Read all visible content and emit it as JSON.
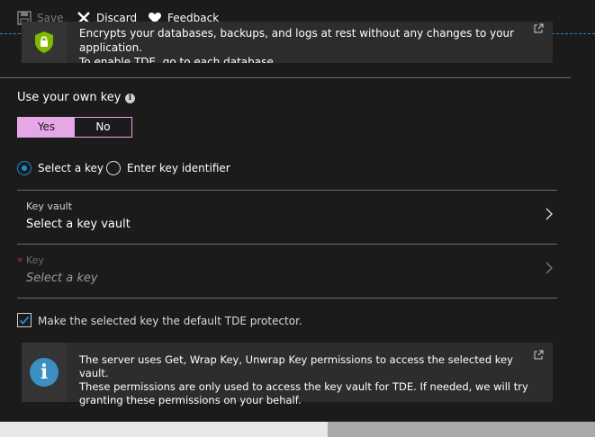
{
  "toolbar": {
    "save_label": "Save",
    "discard_label": "Discard",
    "feedback_label": "Feedback"
  },
  "banner": {
    "line1": "Encrypts your databases, backups, and logs at rest without any changes to your application.",
    "line2": "To enable TDE, go to each database."
  },
  "own_key": {
    "title": "Use your own key",
    "yes_label": "Yes",
    "no_label": "No",
    "selected": "Yes"
  },
  "key_mode": {
    "select_key_label": "Select a key",
    "enter_identifier_label": "Enter key identifier",
    "selected": "Select a key"
  },
  "key_vault": {
    "label": "Key vault",
    "value": "Select a key vault"
  },
  "key": {
    "required_mark": "*",
    "label": "Key",
    "value": "Select a key"
  },
  "default_protector": {
    "label": "Make the selected key the default TDE protector.",
    "checked": true
  },
  "info": {
    "line1": "The server uses Get, Wrap Key, Unwrap Key permissions to access the selected key vault.",
    "line2": "These permissions are only used to access the key vault for TDE. If needed, we will try",
    "line3": "granting these permissions on your behalf."
  },
  "colors": {
    "accent": "#e5a7e6",
    "link_blue": "#1f8bd8",
    "background": "#1b1b1b"
  }
}
